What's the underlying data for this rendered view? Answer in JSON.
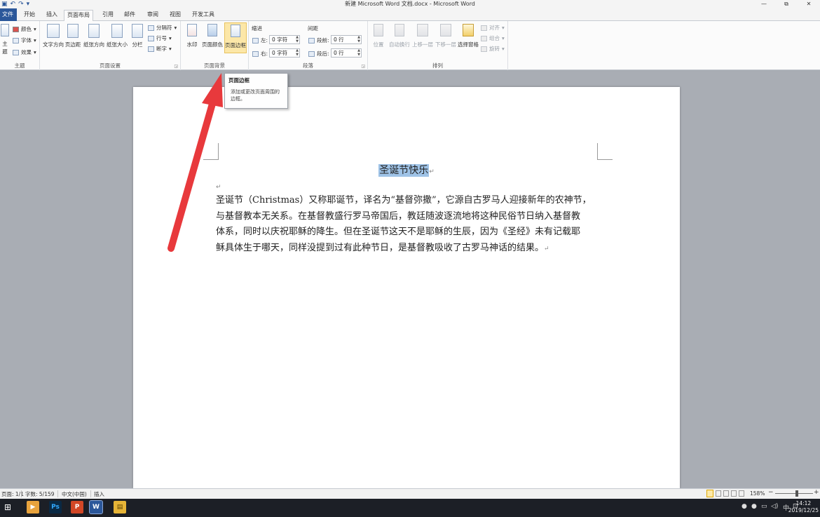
{
  "window": {
    "title": "新建 Microsoft Word 文档.docx - Microsoft Word",
    "minimize_icon": "—",
    "restore_icon": "⧉",
    "close_icon": "✕"
  },
  "qat": {
    "save": "▣",
    "undo": "↶",
    "redo": "↷",
    "more": "▾"
  },
  "tabs": [
    {
      "label": "文件"
    },
    {
      "label": "开始"
    },
    {
      "label": "插入"
    },
    {
      "label": "页面布局"
    },
    {
      "label": "引用"
    },
    {
      "label": "邮件"
    },
    {
      "label": "审阅"
    },
    {
      "label": "视图"
    },
    {
      "label": "开发工具"
    }
  ],
  "ribbon": {
    "theme": {
      "label": "主题",
      "themes": "主题",
      "colors": "颜色",
      "fonts": "字体",
      "effects": "效果"
    },
    "page_setup": {
      "label": "页面设置",
      "text_direction": "文字方向",
      "margins": "页边距",
      "orientation": "纸张方向",
      "size": "纸张大小",
      "columns": "分栏",
      "breaks": "分隔符",
      "line_numbers": "行号",
      "hyphenation": "断字"
    },
    "page_background": {
      "label": "页面背景",
      "watermark": "水印",
      "page_color": "页面颜色",
      "page_borders": "页面边框"
    },
    "paragraph": {
      "label": "段落",
      "indent_title": "缩进",
      "spacing_title": "间距",
      "left_label": "左:",
      "left_value": "0 字符",
      "right_label": "右:",
      "right_value": "0 字符",
      "before_label": "段前:",
      "before_value": "0 行",
      "after_label": "段后:",
      "after_value": "0 行"
    },
    "arrange": {
      "label": "排列",
      "position": "位置",
      "wrap_text": "自动换行",
      "bring_forward": "上移一层",
      "send_backward": "下移一层",
      "selection_pane": "选择窗格",
      "align": "对齐",
      "group": "组合",
      "rotate": "旋转"
    }
  },
  "tooltip": {
    "title": "页面边框",
    "description": "添加或更改页面周围的边框。"
  },
  "document": {
    "title": "圣诞节快乐",
    "pilcrow": "↵",
    "lines": [
      "圣诞节（Christmas）又称耶诞节，译名为“基督弥撒”，它源自古罗马人迎接新年的农神节，",
      "与基督教本无关系。在基督教盛行罗马帝国后，教廷随波逐流地将这种民俗节日纳入基督教",
      "体系，同时以庆祝耶稣的降生。但在圣诞节这天不是耶稣的生辰，因为《圣经》未有记载耶",
      "稣具体生于哪天，同样没提到过有此种节日，是基督教吸收了古罗马神话的结果。"
    ]
  },
  "statusbar": {
    "page": "页面: 1/1",
    "words": "字数: 5/159",
    "language": "中文(中国)",
    "mode": "插入",
    "zoom": "158%",
    "zoom_minus": "−",
    "zoom_plus": "+",
    "zoom_level": 0.58
  },
  "taskbar": {
    "start_icon": "⊞",
    "apps": [
      {
        "glyph": "▶"
      },
      {
        "glyph": "Ps"
      },
      {
        "glyph": "P"
      },
      {
        "glyph": "W"
      },
      {
        "glyph": "▤"
      }
    ],
    "ime": "中",
    "time": "14:12",
    "date": "2019/12/25"
  },
  "colors": {
    "accent": "#2b579a",
    "selection": "#9fc3e7",
    "arrow": "#e8393c"
  }
}
